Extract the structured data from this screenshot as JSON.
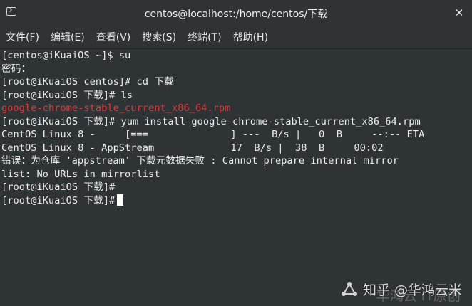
{
  "window": {
    "title": "centos@localhost:/home/centos/下载",
    "close_label": "✕"
  },
  "menu": {
    "items": [
      "文件(F)",
      "编辑(E)",
      "查看(V)",
      "搜索(S)",
      "终端(T)",
      "帮助(H)"
    ]
  },
  "terminal": {
    "lines": [
      {
        "text": "[centos@iKuaiOS ~]$ su",
        "color": "#ececec"
      },
      {
        "text": "密码：",
        "color": "#ececec"
      },
      {
        "text": "[root@iKuaiOS centos]# cd 下载",
        "color": "#ececec"
      },
      {
        "text": "[root@iKuaiOS 下载]# ls",
        "color": "#ececec"
      },
      {
        "text": "google-chrome-stable_current_x86_64.rpm",
        "color": "#e0393b"
      },
      {
        "text": "[root@iKuaiOS 下载]# yum install google-chrome-stable_current_x86_64.rpm",
        "color": "#ececec"
      },
      {
        "text": "CentOS Linux 8 -     [===              ] ---  B/s |   0  B     --:-- ETA",
        "color": "#ececec"
      },
      {
        "text": "CentOS Linux 8 - AppStream             17  B/s |  38  B     00:02",
        "color": "#ececec"
      },
      {
        "text": "错误：为仓库 'appstream' 下载元数据失败 : Cannot prepare internal mirror",
        "color": "#ececec"
      },
      {
        "text": "list: No URLs in mirrorlist",
        "color": "#ececec"
      },
      {
        "text": "[root@iKuaiOS 下载]#",
        "color": "#ececec"
      },
      {
        "text": "[root@iKuaiOS 下载]#",
        "color": "#ececec"
      }
    ]
  },
  "watermark": {
    "text": "知乎 @华鸿云米",
    "shadow_text": "华鸿云 IT原创",
    "logo_icon": "share-node-icon"
  },
  "colors": {
    "background": "#2e3436",
    "foreground": "#ececec",
    "error_red": "#e0393b"
  }
}
